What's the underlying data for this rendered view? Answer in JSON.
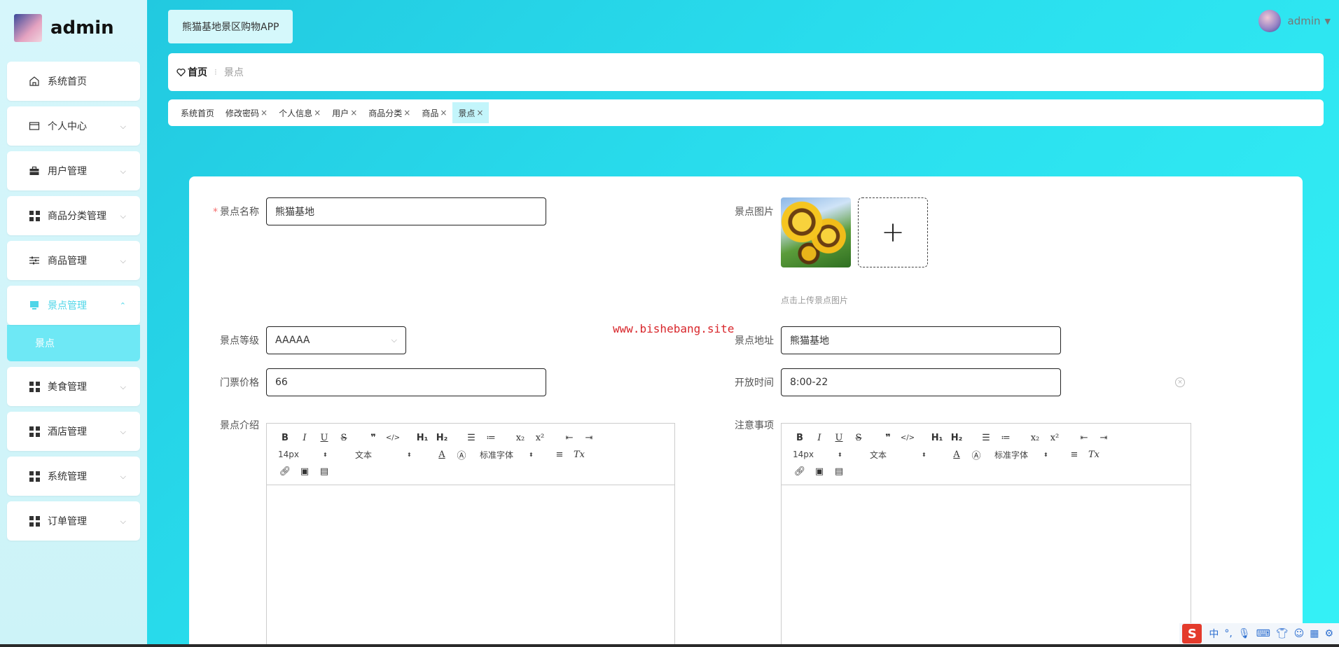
{
  "brand": {
    "name": "admin"
  },
  "sidebar": {
    "items": [
      {
        "label": "系统首页",
        "icon": "home-icon",
        "has_chevron": false
      },
      {
        "label": "个人中心",
        "icon": "card-icon",
        "has_chevron": true
      },
      {
        "label": "用户管理",
        "icon": "briefcase-icon",
        "has_chevron": true
      },
      {
        "label": "商品分类管理",
        "icon": "grid-icon",
        "has_chevron": true
      },
      {
        "label": "商品管理",
        "icon": "sliders-icon",
        "has_chevron": true
      },
      {
        "label": "景点管理",
        "icon": "monitor-icon",
        "has_chevron": true,
        "expanded": true
      },
      {
        "label": "美食管理",
        "icon": "grid-icon",
        "has_chevron": true
      },
      {
        "label": "酒店管理",
        "icon": "grid-icon",
        "has_chevron": true
      },
      {
        "label": "系统管理",
        "icon": "grid-icon",
        "has_chevron": true
      },
      {
        "label": "订单管理",
        "icon": "grid-icon",
        "has_chevron": true
      }
    ],
    "active_sub": "景点"
  },
  "header": {
    "app_title": "熊猫基地景区购物APP",
    "user_name": "admin"
  },
  "breadcrumb": {
    "home": "首页",
    "current": "景点"
  },
  "tabs": [
    {
      "label": "系统首页",
      "closable": false
    },
    {
      "label": "修改密码",
      "closable": true
    },
    {
      "label": "个人信息",
      "closable": true
    },
    {
      "label": "用户",
      "closable": true
    },
    {
      "label": "商品分类",
      "closable": true
    },
    {
      "label": "商品",
      "closable": true
    },
    {
      "label": "景点",
      "closable": true,
      "active": true
    }
  ],
  "form": {
    "name_label": "景点名称",
    "name_value": "熊猫基地",
    "image_label": "景点图片",
    "image_hint": "点击上传景点图片",
    "level_label": "景点等级",
    "level_value": "AAAAA",
    "address_label": "景点地址",
    "address_value": "熊猫基地",
    "price_label": "门票价格",
    "price_value": "66",
    "hours_label": "开放时间",
    "hours_value": "8:00-22",
    "intro_label": "景点介绍",
    "notes_label": "注意事项"
  },
  "editor": {
    "font_size": "14px",
    "text_type": "文本",
    "font_family": "标准字体"
  },
  "watermark": "www.bishebang.site",
  "ime": {
    "lang": "中"
  },
  "colors": {
    "accent": "#4fd6e8",
    "sub_active": "#6ee8f5",
    "required": "#f56c6c",
    "watermark": "#d8262b"
  }
}
